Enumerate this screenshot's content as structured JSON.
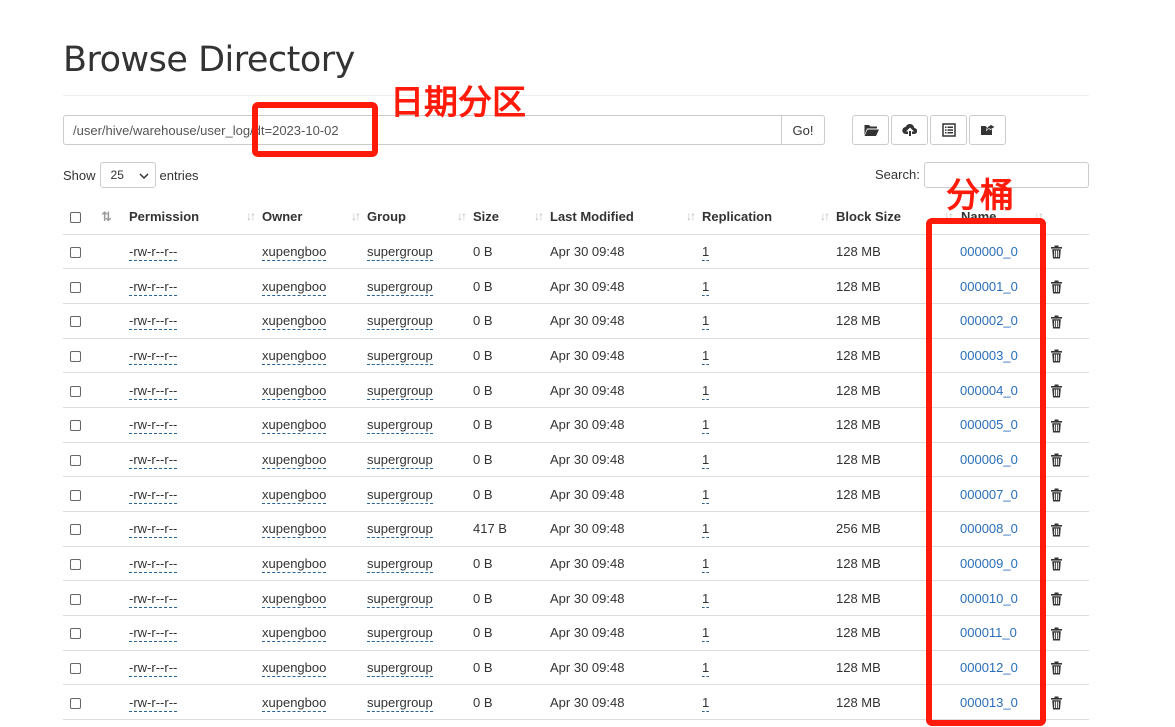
{
  "page": {
    "title": "Browse Directory"
  },
  "path_bar": {
    "value": "/user/hive/warehouse/user_log/dt=2023-10-02",
    "go_label": "Go!"
  },
  "toolbar": {
    "icons": [
      "folder-open-icon",
      "cloud-upload-icon",
      "list-alt-icon",
      "folder-share-icon"
    ]
  },
  "length_menu": {
    "show_label": "Show",
    "selected": "25",
    "entries_label": "entries"
  },
  "search": {
    "label": "Search:",
    "value": ""
  },
  "table": {
    "columns": [
      "Permission",
      "Owner",
      "Group",
      "Size",
      "Last Modified",
      "Replication",
      "Block Size",
      "Name"
    ],
    "rows": [
      {
        "permission": "-rw-r--r--",
        "owner": "xupengboo",
        "group": "supergroup",
        "size": "0 B",
        "modified": "Apr 30 09:48",
        "replication": "1",
        "block_size": "128 MB",
        "name": "000000_0"
      },
      {
        "permission": "-rw-r--r--",
        "owner": "xupengboo",
        "group": "supergroup",
        "size": "0 B",
        "modified": "Apr 30 09:48",
        "replication": "1",
        "block_size": "128 MB",
        "name": "000001_0"
      },
      {
        "permission": "-rw-r--r--",
        "owner": "xupengboo",
        "group": "supergroup",
        "size": "0 B",
        "modified": "Apr 30 09:48",
        "replication": "1",
        "block_size": "128 MB",
        "name": "000002_0"
      },
      {
        "permission": "-rw-r--r--",
        "owner": "xupengboo",
        "group": "supergroup",
        "size": "0 B",
        "modified": "Apr 30 09:48",
        "replication": "1",
        "block_size": "128 MB",
        "name": "000003_0"
      },
      {
        "permission": "-rw-r--r--",
        "owner": "xupengboo",
        "group": "supergroup",
        "size": "0 B",
        "modified": "Apr 30 09:48",
        "replication": "1",
        "block_size": "128 MB",
        "name": "000004_0"
      },
      {
        "permission": "-rw-r--r--",
        "owner": "xupengboo",
        "group": "supergroup",
        "size": "0 B",
        "modified": "Apr 30 09:48",
        "replication": "1",
        "block_size": "128 MB",
        "name": "000005_0"
      },
      {
        "permission": "-rw-r--r--",
        "owner": "xupengboo",
        "group": "supergroup",
        "size": "0 B",
        "modified": "Apr 30 09:48",
        "replication": "1",
        "block_size": "128 MB",
        "name": "000006_0"
      },
      {
        "permission": "-rw-r--r--",
        "owner": "xupengboo",
        "group": "supergroup",
        "size": "0 B",
        "modified": "Apr 30 09:48",
        "replication": "1",
        "block_size": "128 MB",
        "name": "000007_0"
      },
      {
        "permission": "-rw-r--r--",
        "owner": "xupengboo",
        "group": "supergroup",
        "size": "417 B",
        "modified": "Apr 30 09:48",
        "replication": "1",
        "block_size": "256 MB",
        "name": "000008_0"
      },
      {
        "permission": "-rw-r--r--",
        "owner": "xupengboo",
        "group": "supergroup",
        "size": "0 B",
        "modified": "Apr 30 09:48",
        "replication": "1",
        "block_size": "128 MB",
        "name": "000009_0"
      },
      {
        "permission": "-rw-r--r--",
        "owner": "xupengboo",
        "group": "supergroup",
        "size": "0 B",
        "modified": "Apr 30 09:48",
        "replication": "1",
        "block_size": "128 MB",
        "name": "000010_0"
      },
      {
        "permission": "-rw-r--r--",
        "owner": "xupengboo",
        "group": "supergroup",
        "size": "0 B",
        "modified": "Apr 30 09:48",
        "replication": "1",
        "block_size": "128 MB",
        "name": "000011_0"
      },
      {
        "permission": "-rw-r--r--",
        "owner": "xupengboo",
        "group": "supergroup",
        "size": "0 B",
        "modified": "Apr 30 09:48",
        "replication": "1",
        "block_size": "128 MB",
        "name": "000012_0"
      },
      {
        "permission": "-rw-r--r--",
        "owner": "xupengboo",
        "group": "supergroup",
        "size": "0 B",
        "modified": "Apr 30 09:48",
        "replication": "1",
        "block_size": "128 MB",
        "name": "000013_0"
      }
    ]
  },
  "annotations": {
    "partition_label": "日期分区",
    "bucket_label": "分桶",
    "color": "#ff1a0a"
  }
}
